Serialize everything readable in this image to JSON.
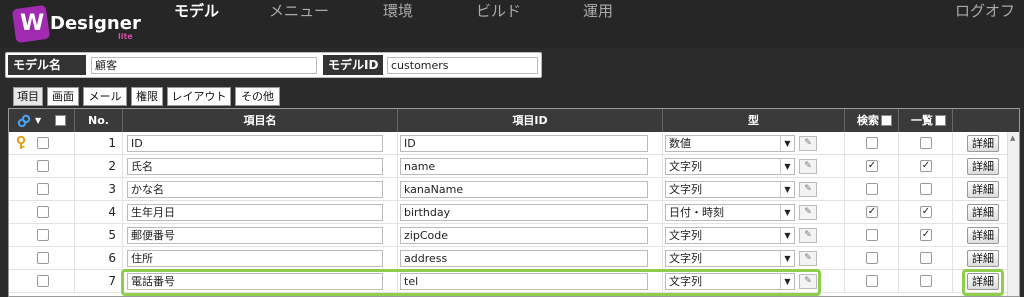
{
  "app": {
    "logo_text": "Designer",
    "logo_sub": "lite"
  },
  "nav": {
    "items": [
      "モデル",
      "メニュー",
      "環境",
      "ビルド",
      "運用"
    ],
    "logout": "ログオフ"
  },
  "model": {
    "name_label": "モデル名",
    "name_value": "顧客",
    "id_label": "モデルID",
    "id_value": "customers"
  },
  "tabs": [
    "項目",
    "画面",
    "メール",
    "権限",
    "レイアウト",
    "その他"
  ],
  "grid": {
    "columns": {
      "no": "No.",
      "name": "項目名",
      "id": "項目ID",
      "type": "型",
      "search": "検索",
      "list": "一覧"
    },
    "detail_label": "詳細",
    "rows": [
      {
        "no": "1",
        "name": "ID",
        "id": "ID",
        "type": "数値",
        "search": false,
        "list": false,
        "key": true
      },
      {
        "no": "2",
        "name": "氏名",
        "id": "name",
        "type": "文字列",
        "search": true,
        "list": true,
        "key": false
      },
      {
        "no": "3",
        "name": "かな名",
        "id": "kanaName",
        "type": "文字列",
        "search": false,
        "list": false,
        "key": false
      },
      {
        "no": "4",
        "name": "生年月日",
        "id": "birthday",
        "type": "日付・時刻",
        "search": true,
        "list": true,
        "key": false
      },
      {
        "no": "5",
        "name": "郵便番号",
        "id": "zipCode",
        "type": "文字列",
        "search": false,
        "list": true,
        "key": false
      },
      {
        "no": "6",
        "name": "住所",
        "id": "address",
        "type": "文字列",
        "search": false,
        "list": false,
        "key": false
      },
      {
        "no": "7",
        "name": "電話番号",
        "id": "tel",
        "type": "文字列",
        "search": false,
        "list": false,
        "key": false
      }
    ]
  },
  "colors": {
    "highlight": "#8fce4b",
    "header": "#3a3a3a",
    "brand": "#a02bb0"
  },
  "icons": {
    "key": "key-icon",
    "link": "link-icon",
    "edit": "edit-icon"
  }
}
